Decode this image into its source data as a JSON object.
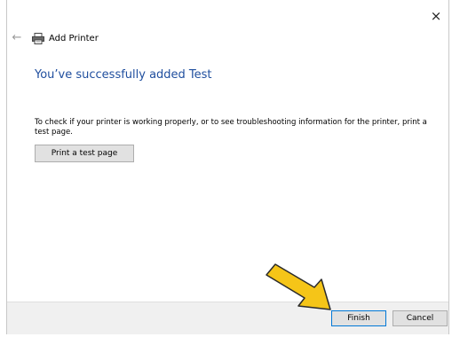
{
  "dialog": {
    "title": "Add Printer",
    "close_glyph": "×",
    "back_glyph": "←",
    "icons": [
      "back-arrow-icon",
      "printer-icon",
      "close-icon"
    ]
  },
  "content": {
    "heading": "You’ve successfully added Test",
    "instructions": "To check if your printer is working properly, or to see troubleshooting information for the printer, print a test page.",
    "test_button_label": "Print a test page"
  },
  "footer": {
    "finish_label": "Finish",
    "cancel_label": "Cancel"
  },
  "colors": {
    "heading": "#1f4e9e",
    "arrow_fill": "#f5c518",
    "arrow_stroke": "#2b2b2b",
    "footer_bg": "#f0f0f0"
  }
}
